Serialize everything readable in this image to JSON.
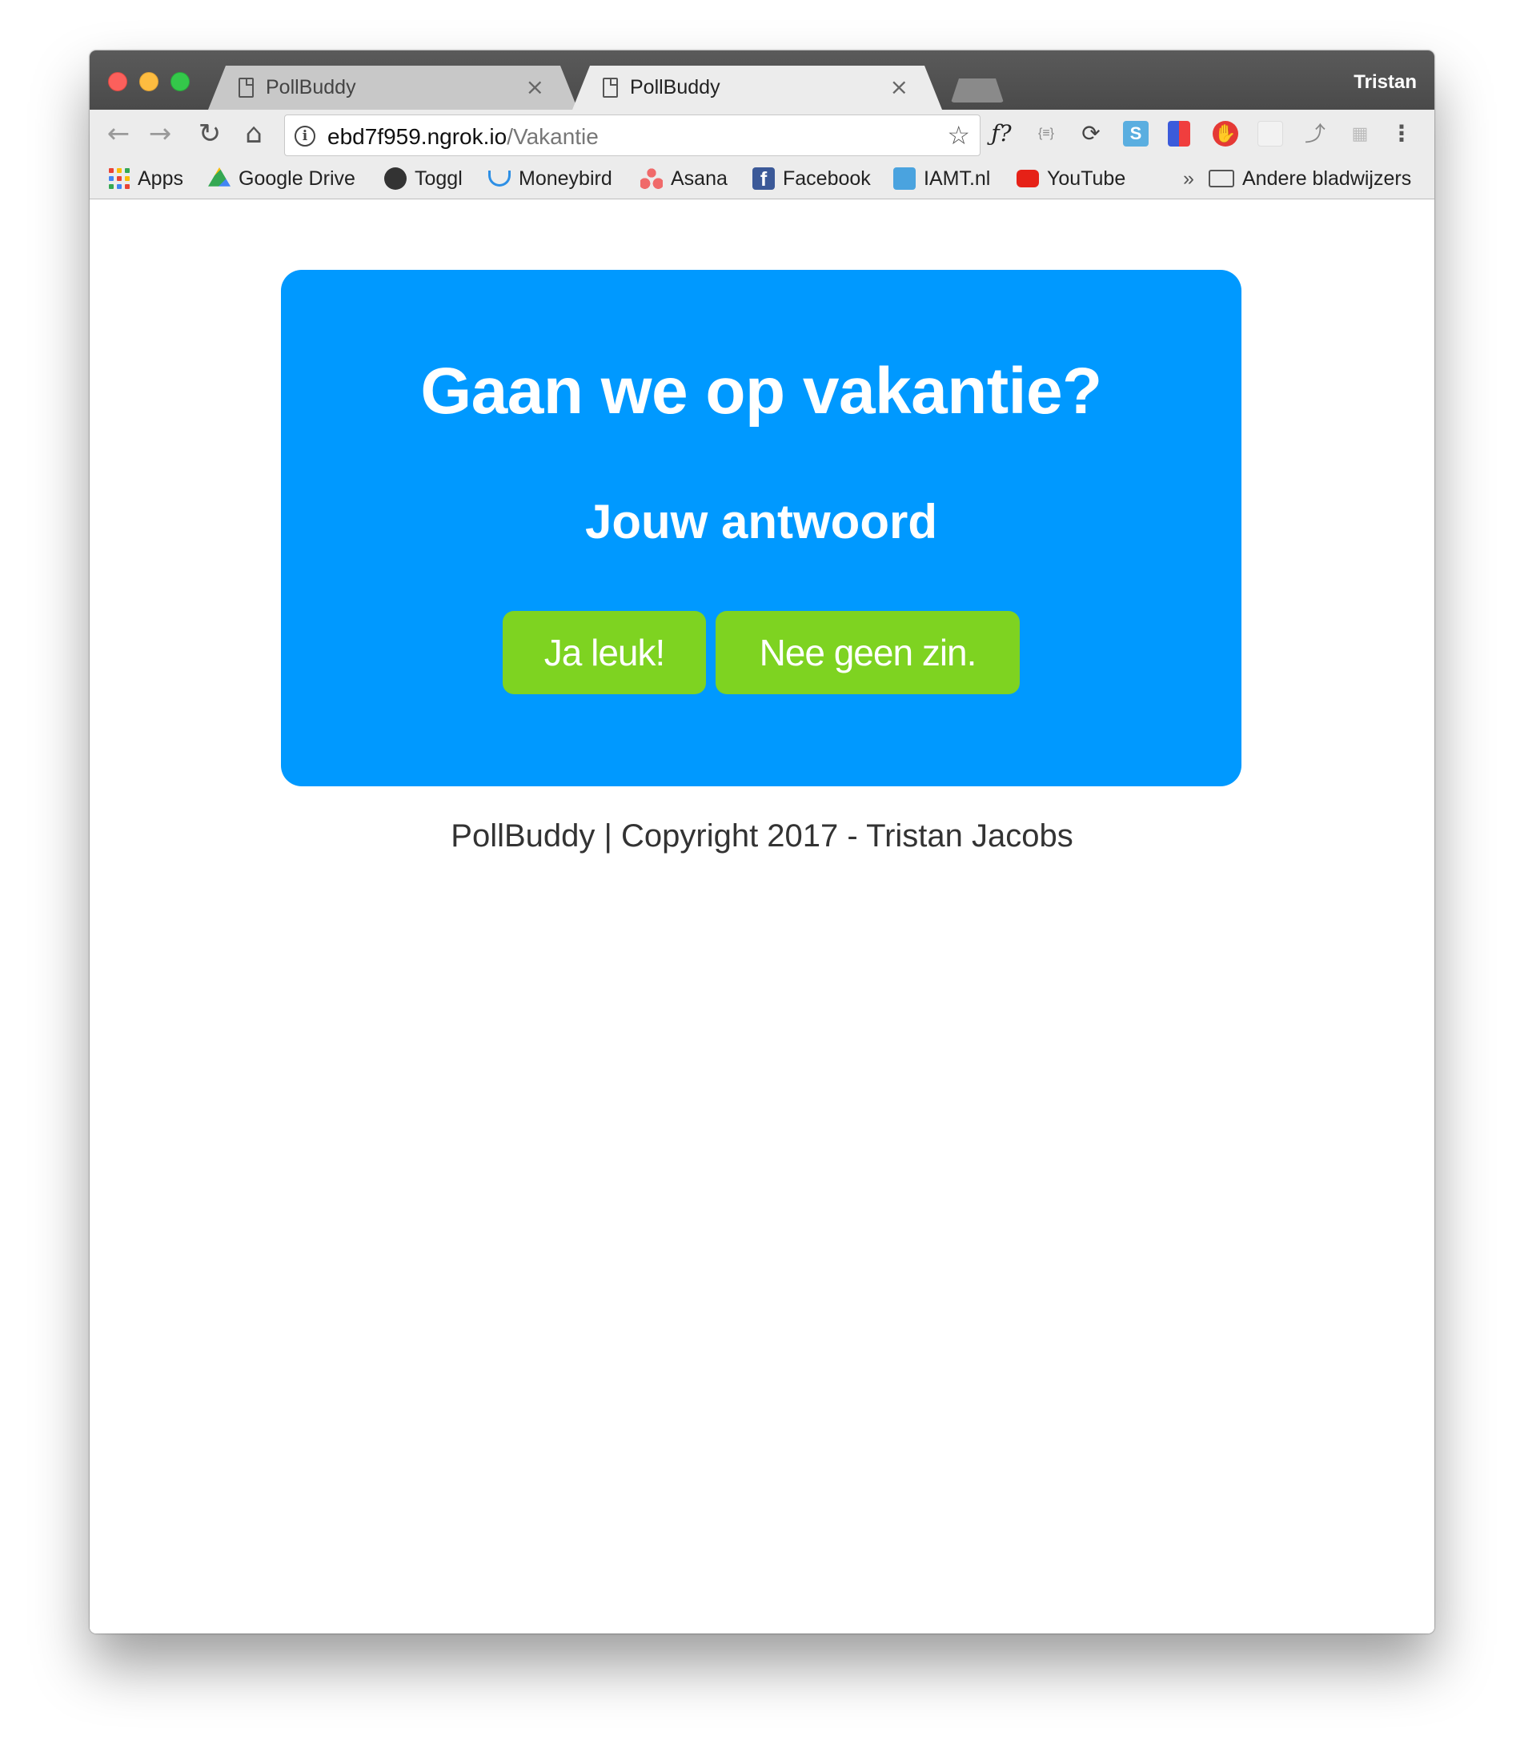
{
  "browser": {
    "profile_name": "Tristan",
    "tabs": [
      {
        "label": "PollBuddy",
        "active": false
      },
      {
        "label": "PollBuddy",
        "active": true
      }
    ],
    "url_host": "ebd7f959.ngrok.io",
    "url_path": "/Vakantie",
    "extensions": [
      "formula-icon",
      "json-icon",
      "sync-icon",
      "skype-icon",
      "lighthouse-icon",
      "adblock-icon",
      "extension-icon",
      "cursor-icon",
      "puzzle-icon",
      "more-icon"
    ],
    "bookmarks": [
      {
        "label": "Apps",
        "icon": "apps-grid-icon"
      },
      {
        "label": "Google Drive",
        "icon": "google-drive-icon"
      },
      {
        "label": "Toggl",
        "icon": "toggl-icon"
      },
      {
        "label": "Moneybird",
        "icon": "moneybird-icon"
      },
      {
        "label": "Asana",
        "icon": "asana-icon"
      },
      {
        "label": "Facebook",
        "icon": "facebook-icon"
      },
      {
        "label": "IAMT.nl",
        "icon": "iamt-icon"
      },
      {
        "label": "YouTube",
        "icon": "youtube-icon"
      }
    ],
    "overflow_label": "»",
    "other_bookmarks": "Andere bladwijzers"
  },
  "poll": {
    "question": "Gaan we op vakantie?",
    "subheading": "Jouw antwoord",
    "answers": [
      "Ja leuk!",
      "Nee geen zin."
    ]
  },
  "footer": {
    "text": "PollBuddy | Copyright 2017 - Tristan Jacobs"
  },
  "colors": {
    "card": "#0099ff",
    "button": "#7ed321",
    "text_on_card": "#ffffff"
  }
}
